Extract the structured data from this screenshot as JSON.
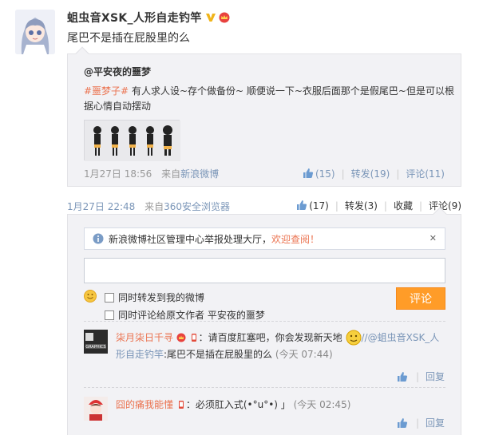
{
  "post": {
    "author": "蛆虫音XSK_人形自走钓竿",
    "text": "尾巴不是插在屁股里的么",
    "time": "1月27日 22:48",
    "source_prefix": "来自",
    "source": "360安全浏览器",
    "actions": {
      "likes": "(17)",
      "repost": "转发(3)",
      "favorite": "收藏",
      "comment": "评论(9)"
    }
  },
  "quote": {
    "author": "@平安夜的噩梦",
    "hashtag": "#噩梦子#",
    "text": " 有人求人设~存个做备份~ 顺便说一下~衣服后面那个是假尾巴~但是可以根据心情自动摆动",
    "time": "1月27日 18:56",
    "source_prefix": "来自",
    "source": "新浪微博",
    "actions": {
      "likes": "(15)",
      "repost": "转发(19)",
      "comment": "评论(11)"
    }
  },
  "comment_panel": {
    "notice_text": "新浪微博社区管理中心举报处理大厅，",
    "notice_link": "欢迎查阅！",
    "notice_close": "✕",
    "option_repost": "同时转发到我的微博",
    "option_comment_to_original": "同时评论给原文作者 平安夜的噩梦",
    "submit_label": "评论"
  },
  "comments": [
    {
      "user": "柒月柒日千寻",
      "text_before": "：请百度肛塞吧，你会发现新天地",
      "mention": "//@蛆虫音XSK_人形自走钓竿",
      "text_after": ":尾巴不是插在屁股里的么",
      "time": "(今天 07:44)",
      "reply_label": "回复"
    },
    {
      "user": "囧的痛我能懂",
      "text_before": "：必须肛入式(•°u°•) 」",
      "mention": "",
      "text_after": "",
      "time": "(今天 02:45)",
      "reply_label": "回复"
    }
  ],
  "colors": {
    "link": "#7b96b8",
    "highlight": "#eb7350",
    "submit": "#ff9c28"
  }
}
